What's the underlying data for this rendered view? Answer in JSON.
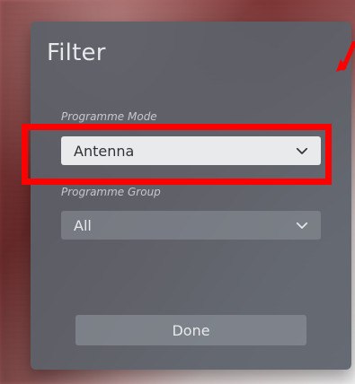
{
  "dialog": {
    "title": "Filter",
    "programme_mode": {
      "label": "Programme Mode",
      "value": "Antenna"
    },
    "programme_group": {
      "label": "Programme Group",
      "value": "All"
    },
    "done_label": "Done"
  },
  "annotations": {
    "highlight_color": "#ff0000",
    "arrow_color": "#ff0000",
    "arrow_icon": "arrow-pointer-icon"
  },
  "icons": {
    "dropdown": "chevron-down-icon"
  }
}
